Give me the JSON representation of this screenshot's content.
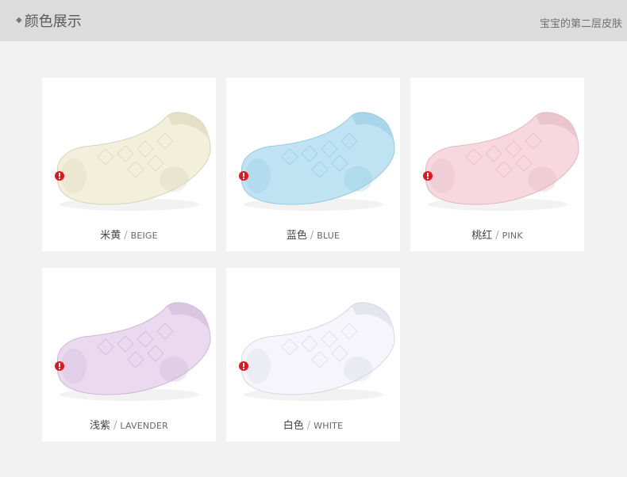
{
  "header": {
    "title": "颜色展示",
    "subtitle": "宝宝的第二层皮肤"
  },
  "products": [
    {
      "cn": "米黄",
      "en": "BEIGE",
      "color": "#f2efda",
      "shade": "#d9d4ba"
    },
    {
      "cn": "蓝色",
      "en": "BLUE",
      "color": "#bfe3f3",
      "shade": "#96cbe2"
    },
    {
      "cn": "桃红",
      "en": "PINK",
      "color": "#f7d8df",
      "shade": "#e2b6c0"
    },
    {
      "cn": "浅紫",
      "en": "LAVENDER",
      "color": "#ead9ef",
      "shade": "#cdb7d6"
    },
    {
      "cn": "白色",
      "en": "WHITE",
      "color": "#f5f5fb",
      "shade": "#d7d7e4"
    }
  ],
  "separator": "/",
  "tag_color": "#e8141b"
}
